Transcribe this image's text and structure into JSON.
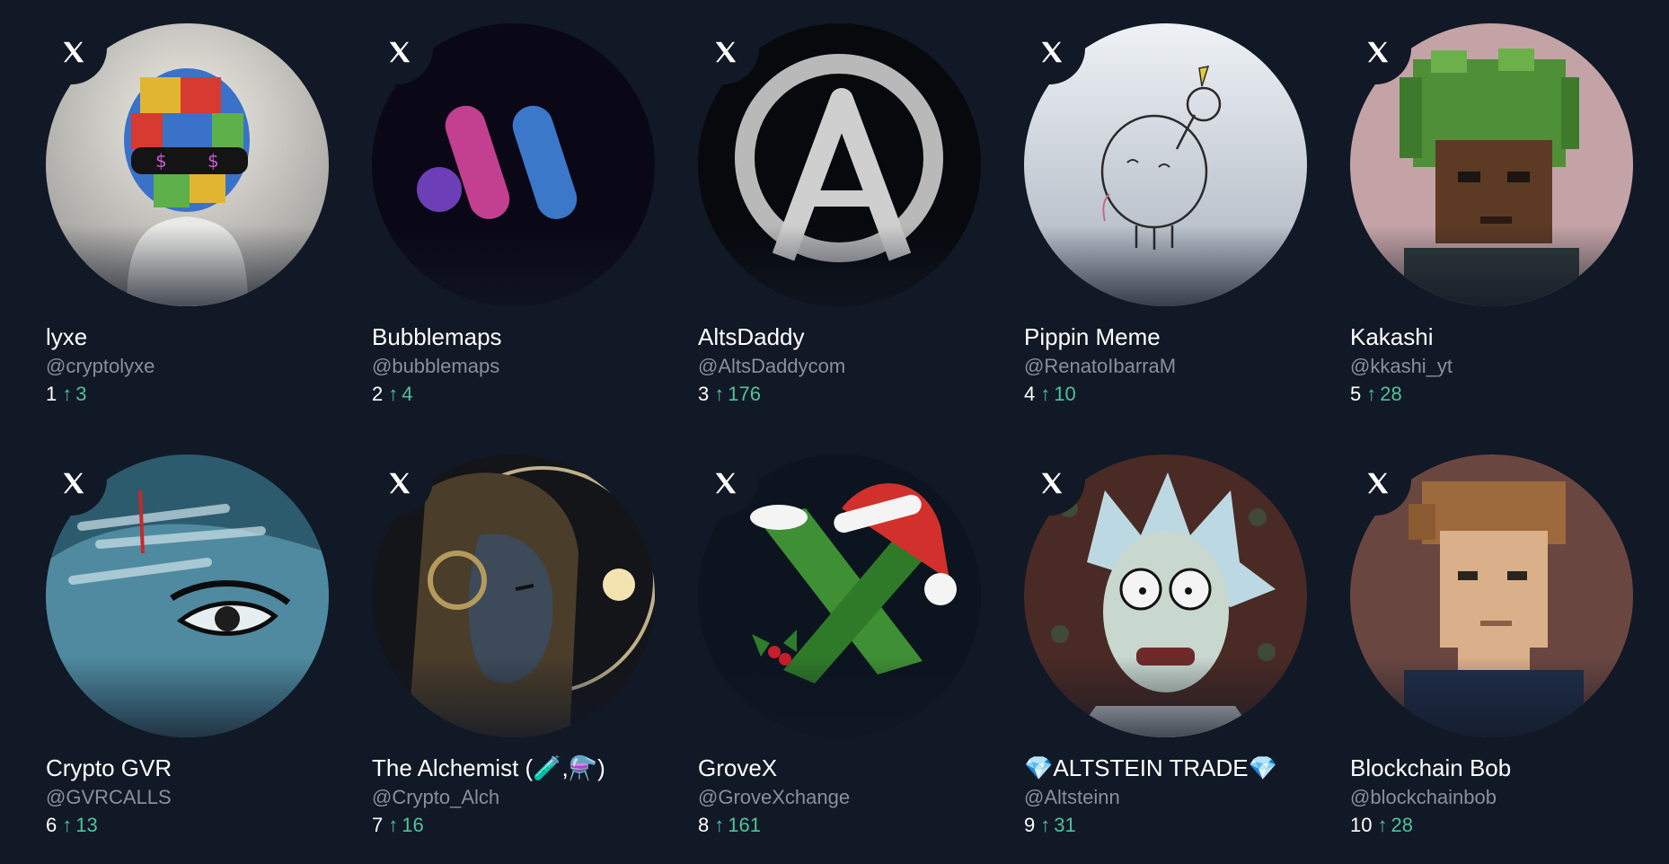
{
  "accounts": [
    {
      "rank": "1",
      "name": "lyxe",
      "handle": "@cryptolyxe",
      "change": "3",
      "arrow": "↑",
      "avatar": "puzzle-hood-avatar"
    },
    {
      "rank": "2",
      "name": "Bubblemaps",
      "handle": "@bubblemaps",
      "change": "4",
      "arrow": "↑",
      "avatar": "bubblemaps-logo-avatar"
    },
    {
      "rank": "3",
      "name": "AltsDaddy",
      "handle": "@AltsDaddycom",
      "change": "176",
      "arrow": "↑",
      "avatar": "a-circle-logo-avatar"
    },
    {
      "rank": "4",
      "name": "Pippin Meme",
      "handle": "@RenatoIbarraM",
      "change": "10",
      "arrow": "↑",
      "avatar": "pippin-sketch-avatar"
    },
    {
      "rank": "5",
      "name": "Kakashi",
      "handle": "@kkashi_yt",
      "change": "28",
      "arrow": "↑",
      "avatar": "pixel-green-hair-avatar"
    },
    {
      "rank": "6",
      "name": "Crypto GVR",
      "handle": "@GVRCALLS",
      "change": "13",
      "arrow": "↑",
      "avatar": "painted-eye-avatar"
    },
    {
      "rank": "7",
      "name": "The Alchemist (🧪,⚗️)",
      "handle": "@Crypto_Alch",
      "change": "16",
      "arrow": "↑",
      "avatar": "alchemist-portrait-avatar"
    },
    {
      "rank": "8",
      "name": "GroveX",
      "handle": "@GroveXchange",
      "change": "161",
      "arrow": "↑",
      "avatar": "grovex-santa-hat-avatar"
    },
    {
      "rank": "9",
      "name": "💎ALTSTEIN TRADE💎",
      "handle": "@Altsteinn",
      "change": "31",
      "arrow": "↑",
      "avatar": "cartoon-scientist-avatar"
    },
    {
      "rank": "10",
      "name": "Blockchain Bob",
      "handle": "@blockchainbob",
      "change": "28",
      "arrow": "↑",
      "avatar": "pixel-brown-hair-avatar"
    }
  ],
  "colors": {
    "background": "#111826",
    "positive": "#4fc39a",
    "muted": "#8a8f99"
  }
}
